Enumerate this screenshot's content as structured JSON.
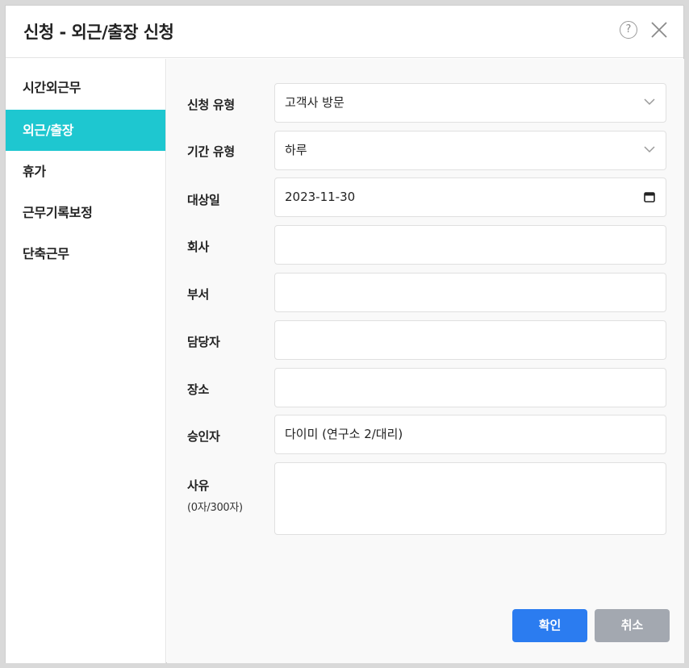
{
  "dialog": {
    "title": "신청 - 외근/출장 신청",
    "help_label": "?"
  },
  "sidebar": {
    "items": [
      {
        "label": "시간외근무",
        "active": false
      },
      {
        "label": "외근/출장",
        "active": true
      },
      {
        "label": "휴가",
        "active": false
      },
      {
        "label": "근무기록보정",
        "active": false
      },
      {
        "label": "단축근무",
        "active": false
      }
    ]
  },
  "form": {
    "request_type": {
      "label": "신청 유형",
      "value": "고객사 방문"
    },
    "period_type": {
      "label": "기간 유형",
      "value": "하루"
    },
    "target_date": {
      "label": "대상일",
      "value": "2023-11-30"
    },
    "company": {
      "label": "회사",
      "value": ""
    },
    "department": {
      "label": "부서",
      "value": ""
    },
    "manager": {
      "label": "담당자",
      "value": ""
    },
    "place": {
      "label": "장소",
      "value": ""
    },
    "approver": {
      "label": "승인자",
      "value": "다이미 (연구소 2/대리)"
    },
    "reason": {
      "label": "사유",
      "counter": "(0자/300자)",
      "value": ""
    }
  },
  "buttons": {
    "confirm": "확인",
    "cancel": "취소"
  },
  "colors": {
    "accent": "#1ec7d0",
    "primary_button": "#2b7cf0",
    "secondary_button": "#a3a8b0"
  },
  "icons": [
    "help-icon",
    "close-icon",
    "chevron-down-icon",
    "calendar-icon"
  ]
}
